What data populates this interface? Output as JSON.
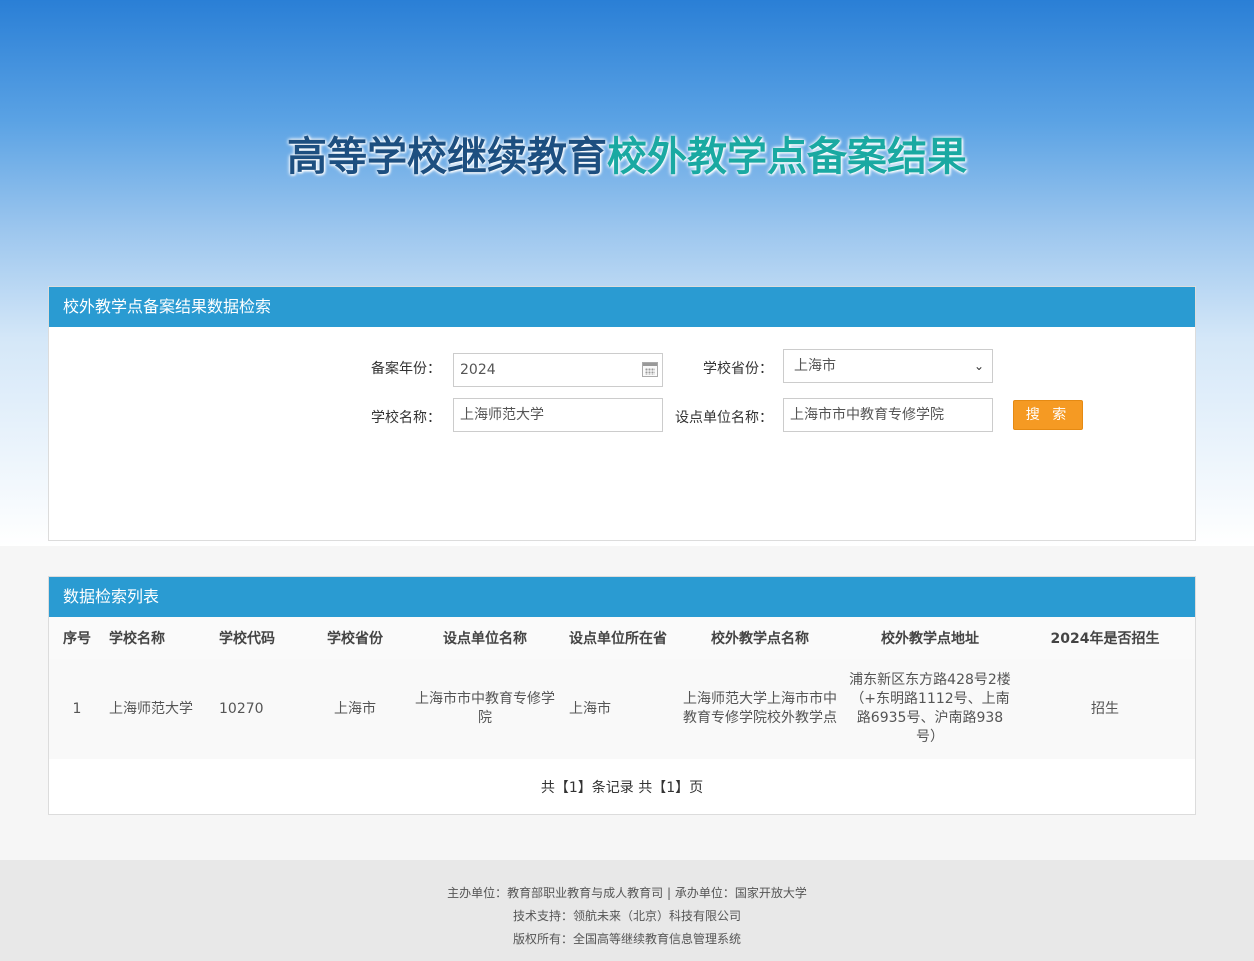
{
  "banner": {
    "title_part1": "高等学校继续教育",
    "title_part2": "校外教学点备案结果"
  },
  "search": {
    "panel_title": "校外教学点备案结果数据检索",
    "year_label": "备案年份：",
    "year_value": "2024",
    "province_label": "学校省份：",
    "province_value": "上海市",
    "school_label": "学校名称：",
    "school_value": "上海师范大学",
    "unit_label": "设点单位名称：",
    "unit_value": "上海市市中教育专修学院",
    "search_button": "搜 索"
  },
  "list": {
    "panel_title": "数据检索列表",
    "columns": [
      "序号",
      "学校名称",
      "学校代码",
      "学校省份",
      "设点单位名称",
      "设点单位所在省",
      "校外教学点名称",
      "校外教学点地址",
      "2024年是否招生"
    ],
    "rows": [
      [
        "1",
        "上海师范大学",
        "10270",
        "上海市",
        "上海市市中教育专修学院",
        "上海市",
        "上海师范大学上海市市中教育专修学院校外教学点",
        "浦东新区东方路428号2楼（+东明路1112号、上南路6935号、沪南路938号）",
        "招生"
      ]
    ],
    "pager": "共【1】条记录 共【1】页"
  },
  "footer": {
    "line1": "主办单位：教育部职业教育与成人教育司 | 承办单位：国家开放大学",
    "line2": "技术支持：领航未来（北京）科技有限公司",
    "line3": "版权所有：全国高等继续教育信息管理系统"
  },
  "colors": {
    "header_bar": "#2a9bd2",
    "search_button": "#f59a23",
    "title_dark": "#1d4f80",
    "title_teal": "#1aa9a2"
  },
  "icons": {
    "calendar": "calendar-icon",
    "dropdown": "chevron-down-icon"
  }
}
